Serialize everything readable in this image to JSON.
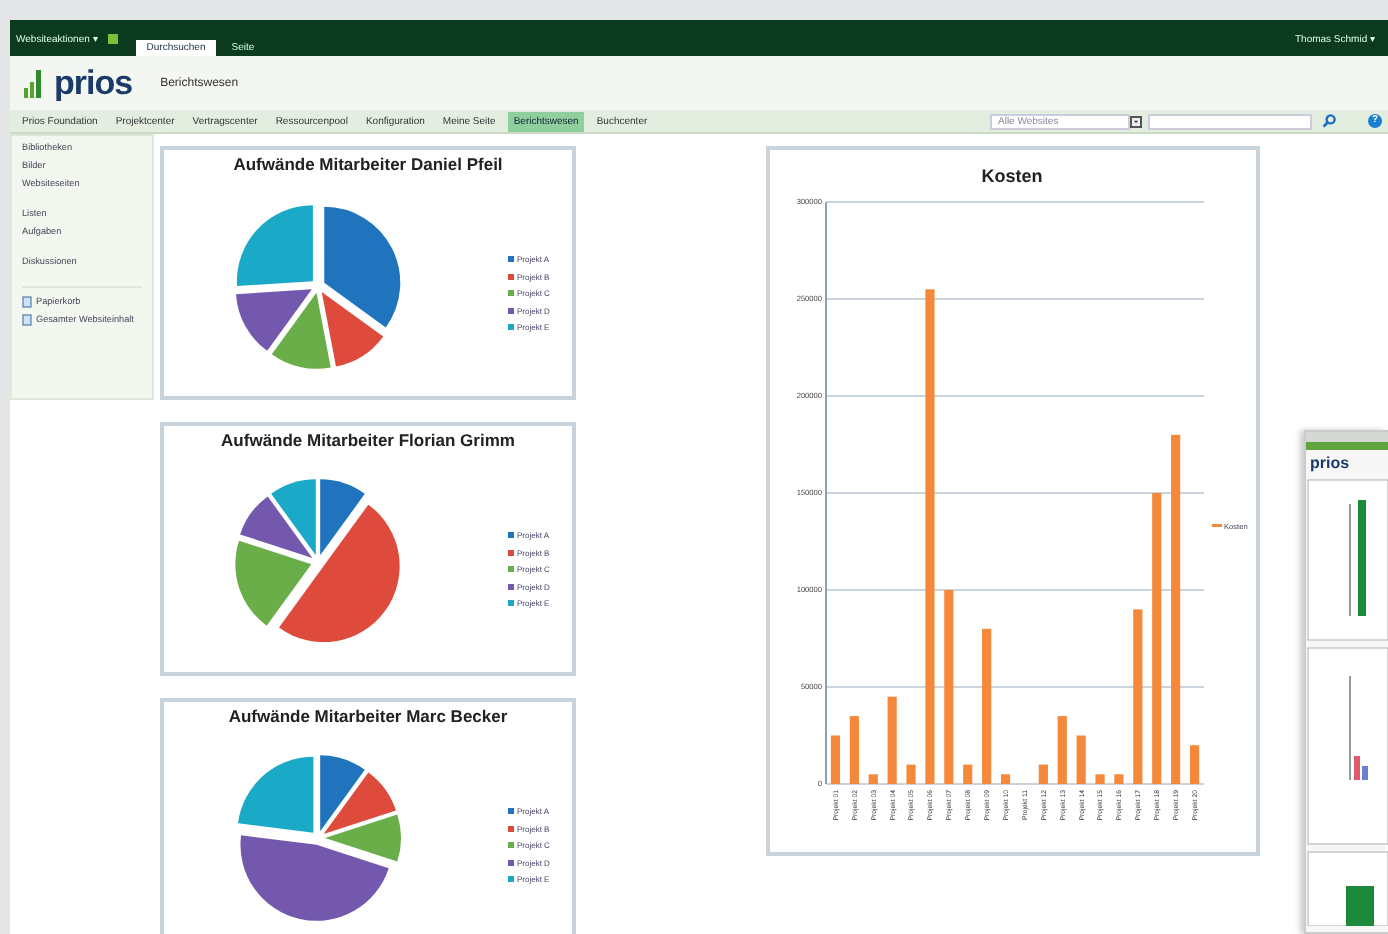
{
  "top_bar": {
    "site_actions": "Websiteaktionen ▾",
    "tabs": [
      {
        "label": "Durchsuchen",
        "selected": true
      },
      {
        "label": "Seite",
        "selected": false
      }
    ],
    "user": "Thomas Schmid ▾"
  },
  "header": {
    "logo": "prios",
    "site_title": "Berichtswesen"
  },
  "nav": {
    "items": [
      {
        "label": "Prios Foundation",
        "selected": false
      },
      {
        "label": "Projektcenter",
        "selected": false
      },
      {
        "label": "Vertragscenter",
        "selected": false
      },
      {
        "label": "Ressourcenpool",
        "selected": false
      },
      {
        "label": "Konfiguration",
        "selected": false
      },
      {
        "label": "Meine Seite",
        "selected": false
      },
      {
        "label": "Berichtswesen",
        "selected": true
      },
      {
        "label": "Buchcenter",
        "selected": false
      }
    ],
    "search_scope": "Alle Websites",
    "help": "?"
  },
  "sidebar": {
    "groups": [
      {
        "items": [
          "Bibliotheken",
          "Bilder",
          "Websiteseiten"
        ]
      },
      {
        "items": [
          "Listen",
          "Aufgaben"
        ]
      },
      {
        "items": [
          "Diskussionen"
        ]
      }
    ],
    "links": [
      "Papierkorb",
      "Gesamter Websiteinhalt"
    ]
  },
  "pie_charts": [
    {
      "title": "Aufwände Mitarbeiter Daniel Pfeil",
      "legend": [
        {
          "label": "Projekt A",
          "color": "#1f74bd"
        },
        {
          "label": "Projekt B",
          "color": "#de4a3c"
        },
        {
          "label": "Projekt C",
          "color": "#6aae4a"
        },
        {
          "label": "Projekt D",
          "color": "#7458ad"
        },
        {
          "label": "Projekt E",
          "color": "#1aa9c6"
        }
      ]
    },
    {
      "title": "Aufwände Mitarbeiter Florian Grimm",
      "legend": [
        {
          "label": "Projekt A",
          "color": "#1f74bd"
        },
        {
          "label": "Projekt B",
          "color": "#de4a3c"
        },
        {
          "label": "Projekt C",
          "color": "#6aae4a"
        },
        {
          "label": "Projekt D",
          "color": "#7458ad"
        },
        {
          "label": "Projekt E",
          "color": "#1aa9c6"
        }
      ]
    },
    {
      "title": "Aufwände Mitarbeiter Marc Becker",
      "legend": [
        {
          "label": "Projekt A",
          "color": "#1f74bd"
        },
        {
          "label": "Projekt B",
          "color": "#de4a3c"
        },
        {
          "label": "Projekt C",
          "color": "#6aae4a"
        },
        {
          "label": "Projekt D",
          "color": "#7458ad"
        },
        {
          "label": "Projekt E",
          "color": "#1aa9c6"
        }
      ]
    }
  ],
  "cost_chart": {
    "chart_data": {
      "type": "bar",
      "title": "Kosten",
      "categories": [
        "Projekt 01",
        "Projekt 02",
        "Projekt 03",
        "Projekt 04",
        "Projekt 05",
        "Projekt 06",
        "Projekt 07",
        "Projekt 08",
        "Projekt 09",
        "Projekt 10",
        "Projekt 11",
        "Projekt 12",
        "Projekt 13",
        "Projekt 14",
        "Projekt 15",
        "Projekt 16",
        "Projekt 17",
        "Projekt 18",
        "Projekt 19",
        "Projekt 20"
      ],
      "series": [
        {
          "name": "Kosten",
          "color": "#f5893b",
          "values": [
            25000,
            35000,
            5000,
            45000,
            10000,
            255000,
            100000,
            10000,
            80000,
            5000,
            0,
            10000,
            35000,
            25000,
            5000,
            5000,
            90000,
            150000,
            180000,
            20000
          ]
        }
      ],
      "grid": true,
      "ylim": [
        0,
        300000
      ],
      "yticks": [
        0,
        50000,
        100000,
        150000,
        200000,
        250000,
        300000
      ]
    }
  },
  "preview": {
    "logo": "prios"
  }
}
